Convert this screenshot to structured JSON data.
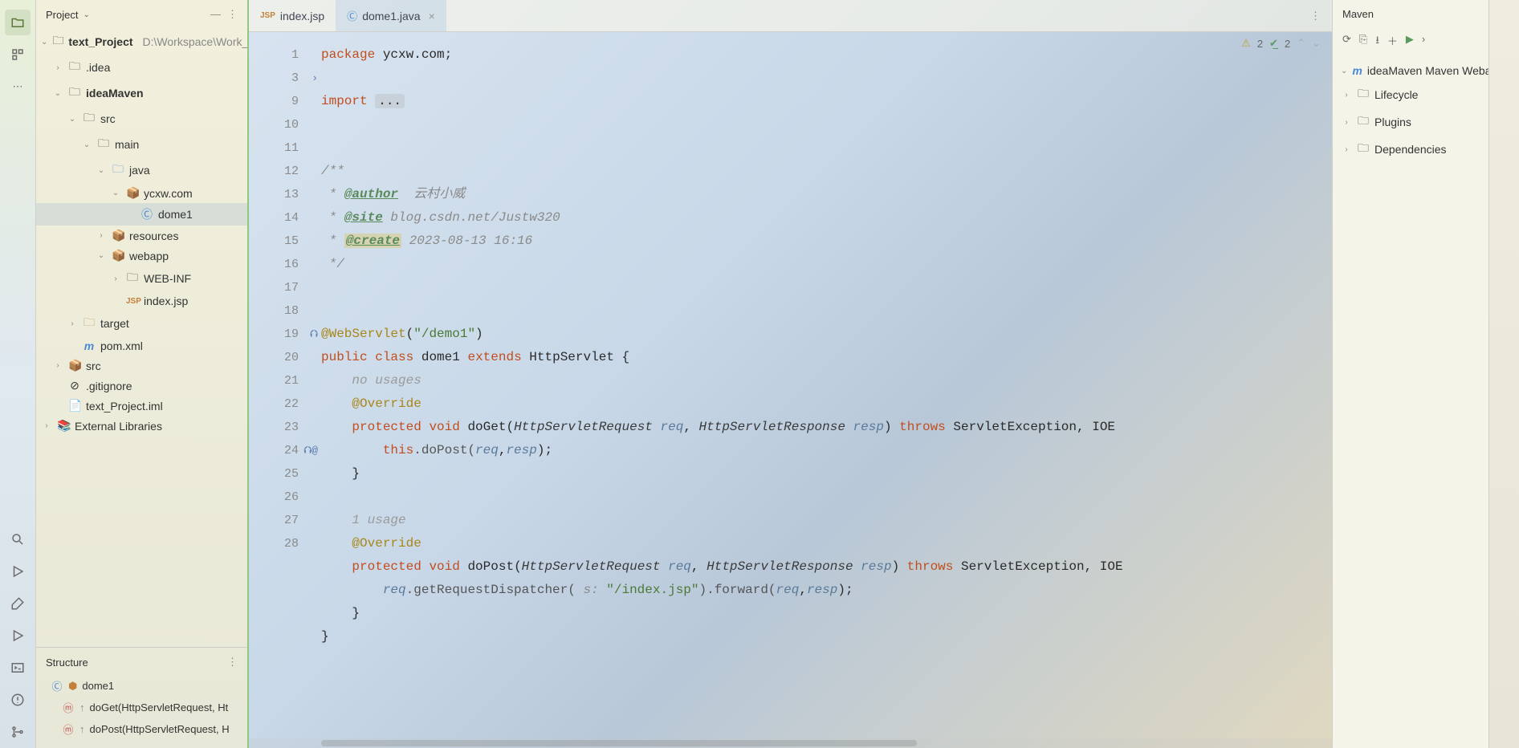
{
  "leftbar": {
    "icons": [
      "folder-icon",
      "structure-icon",
      "more-icon"
    ],
    "bottom_icons": [
      "search-icon",
      "run-icon",
      "build-icon",
      "debug-icon",
      "terminal-icon",
      "problems-icon",
      "vcs-icon"
    ]
  },
  "project_panel": {
    "title": "Project",
    "root": {
      "name": "text_Project",
      "hint": "D:\\Workspace\\Work_"
    },
    "nodes": {
      "idea": ".idea",
      "ideaMaven": "ideaMaven",
      "src": "src",
      "main": "main",
      "java": "java",
      "pkg": "ycxw.com",
      "dome1": "dome1",
      "resources": "resources",
      "webapp": "webapp",
      "webinf": "WEB-INF",
      "indexjsp": "index.jsp",
      "target": "target",
      "pom": "pom.xml",
      "src2": "src",
      "gitignore": ".gitignore",
      "iml": "text_Project.iml",
      "extlib": "External Libraries"
    }
  },
  "structure_panel": {
    "title": "Structure",
    "class": "dome1",
    "methods": {
      "doGet": "doGet(HttpServletRequest, Ht",
      "doPost": "doPost(HttpServletRequest, H"
    }
  },
  "tabs": {
    "items": [
      {
        "icon": "JSP",
        "label": "index.jsp",
        "active": false
      },
      {
        "icon": "C",
        "label": "dome1.java",
        "active": true
      }
    ]
  },
  "inspections": {
    "warn_count": "2",
    "ok_count": "2"
  },
  "code": {
    "ln1_kw": "package",
    "ln1_rest": " ycxw.com;",
    "ln3_kw": "import",
    "ln3_fold": "...",
    "ln10": "/**",
    "ln11_pre": " * ",
    "ln11_tag": "@author",
    "ln11_txt": "  云村小威",
    "ln12_pre": " * ",
    "ln12_tag": "@site",
    "ln12_txt": " blog.csdn.net/Justw320",
    "ln13_pre": " * ",
    "ln13_tag": "@create",
    "ln13_txt": " 2023-08-13 16:16",
    "ln14": " */",
    "ln16_ann": "@WebServlet",
    "ln16_p1": "(",
    "ln16_str": "\"/demo1\"",
    "ln16_p2": ")",
    "ln17_kw1": "public",
    "ln17_kw2": "class",
    "ln17_name": "dome1",
    "ln17_ext": "extends",
    "ln17_sup": "HttpServlet",
    "ln17_br": " {",
    "hint1": "no usages",
    "ln18_ann": "@Override",
    "ln19_kw1": "protected",
    "ln19_kw2": "void",
    "ln19_name": "doGet",
    "ln19_p1": "(",
    "ln19_t1": "HttpServletRequest",
    "ln19_a1": " req",
    "ln19_c1": ", ",
    "ln19_t2": "HttpServletResponse",
    "ln19_a2": " resp",
    "ln19_p2": ") ",
    "ln19_kw3": "throws",
    "ln19_ex": " ServletException, IOE",
    "ln20_this": "this",
    "ln20_call": ".doPost(",
    "ln20_a1": "req",
    "ln20_c": ",",
    "ln20_a2": "resp",
    "ln20_end": ");",
    "ln21": "}",
    "hint2": "1 usage",
    "ln23_ann": "@Override",
    "ln24_kw1": "protected",
    "ln24_kw2": "void",
    "ln24_name": "doPost",
    "ln24_p1": "(",
    "ln24_t1": "HttpServletRequest",
    "ln24_a1": " req",
    "ln24_c1": ", ",
    "ln24_t2": "HttpServletResponse",
    "ln24_a2": " resp",
    "ln24_p2": ") ",
    "ln24_kw3": "throws",
    "ln24_ex": " ServletException, IOE",
    "ln25_a": "req",
    "ln25_m": ".getRequestDispatcher( ",
    "ln25_ih": "s:",
    "ln25_str": " \"/index.jsp\"",
    "ln25_m2": ").forward(",
    "ln25_a1": "req",
    "ln25_c": ",",
    "ln25_a2": "resp",
    "ln25_end": ");",
    "ln26": "}",
    "ln27": "}",
    "line_numbers": [
      "1",
      "",
      "3",
      "9",
      "",
      "10",
      "11",
      "12",
      "13",
      "14",
      "15",
      "",
      "16",
      "17",
      "",
      "18",
      "19",
      "20",
      "21",
      "22",
      "",
      "23",
      "24",
      "25",
      "26",
      "27",
      "",
      "28"
    ]
  },
  "maven": {
    "title": "Maven",
    "project": "ideaMaven Maven Weba",
    "lifecycle": "Lifecycle",
    "plugins": "Plugins",
    "deps": "Dependencies"
  }
}
